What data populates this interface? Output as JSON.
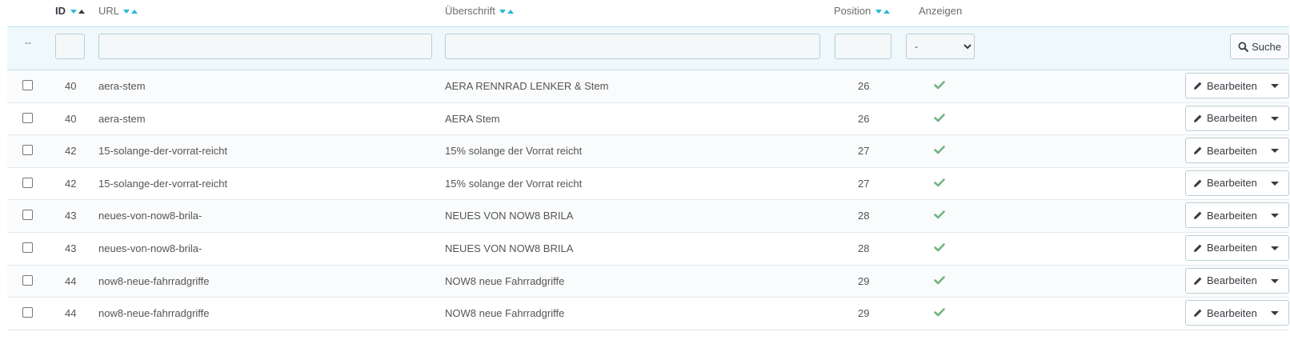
{
  "headers": {
    "id": "ID",
    "url": "URL",
    "title": "Überschrift",
    "position": "Position",
    "show": "Anzeigen"
  },
  "filters": {
    "reset_label": "--",
    "show_selected": "-",
    "search_label": "Suche"
  },
  "edit_label": "Bearbeiten",
  "colors": {
    "accent": "#25b9d7",
    "check": "#70b580",
    "filter_bg": "#eff8fb"
  },
  "rows": [
    {
      "id": "40",
      "url": "aera-stem",
      "title": "AERA RENNRAD LENKER & Stem",
      "position": "26",
      "shown": true
    },
    {
      "id": "40",
      "url": "aera-stem",
      "title": "AERA Stem",
      "position": "26",
      "shown": true
    },
    {
      "id": "42",
      "url": "15-solange-der-vorrat-reicht",
      "title": "15% solange der Vorrat reicht",
      "position": "27",
      "shown": true
    },
    {
      "id": "42",
      "url": "15-solange-der-vorrat-reicht",
      "title": "15% solange der Vorrat reicht",
      "position": "27",
      "shown": true
    },
    {
      "id": "43",
      "url": "neues-von-now8-brila-",
      "title": "NEUES VON NOW8 BRILA",
      "position": "28",
      "shown": true
    },
    {
      "id": "43",
      "url": "neues-von-now8-brila-",
      "title": "NEUES VON NOW8 BRILA",
      "position": "28",
      "shown": true
    },
    {
      "id": "44",
      "url": "now8-neue-fahrradgriffe",
      "title": "NOW8 neue Fahrradgriffe",
      "position": "29",
      "shown": true
    },
    {
      "id": "44",
      "url": "now8-neue-fahrradgriffe",
      "title": "NOW8 neue Fahrradgriffe",
      "position": "29",
      "shown": true
    }
  ]
}
